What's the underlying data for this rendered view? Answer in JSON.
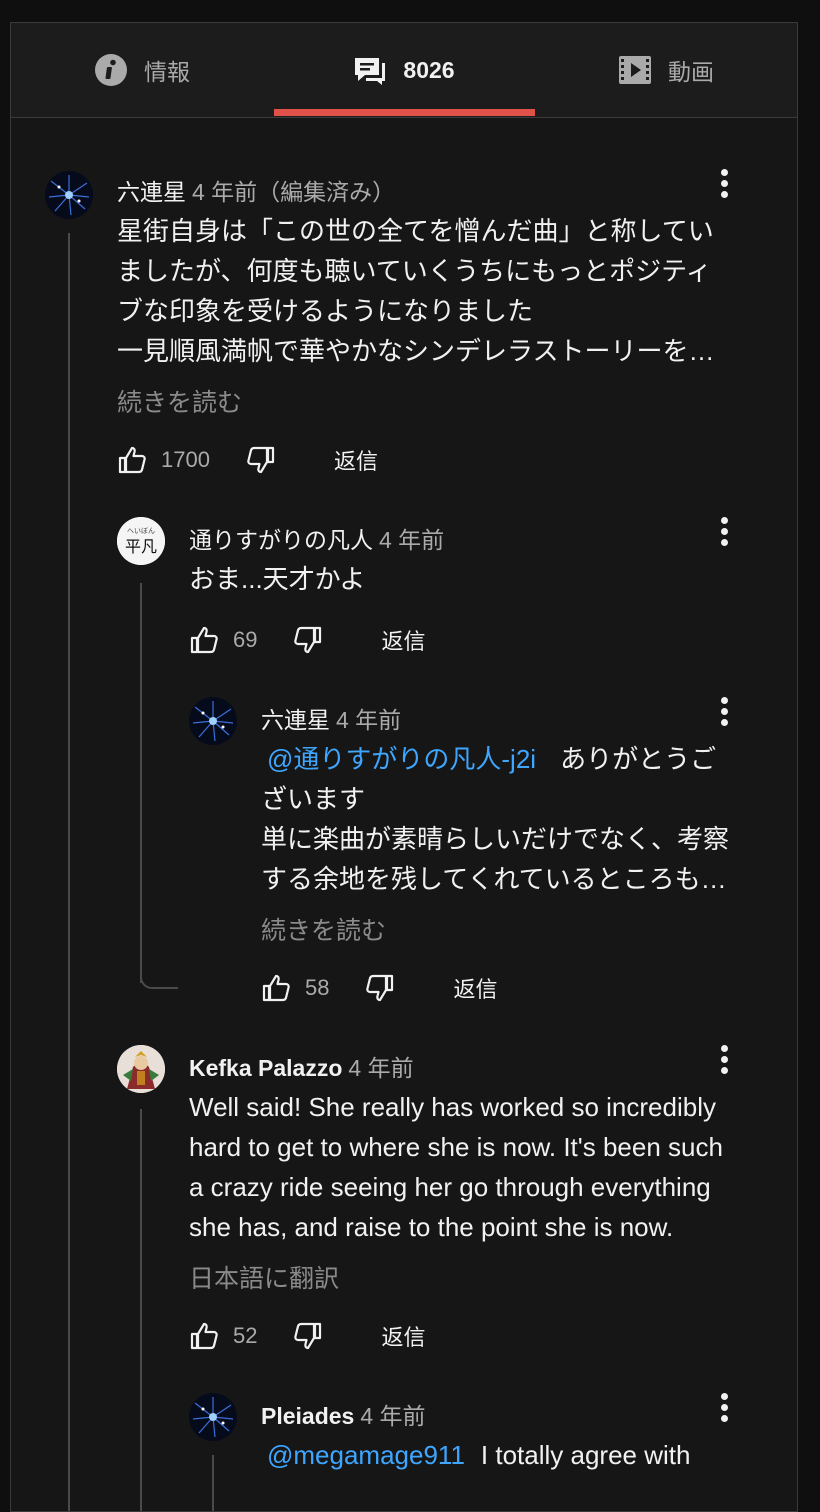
{
  "tabs": {
    "info_label": "情報",
    "comments_count": "8026",
    "video_label": "動画"
  },
  "comments": [
    {
      "author": "六連星",
      "time": "4 年前（編集済み）",
      "lines": [
        "星街自身は「この世の全てを憎んだ曲」と称してい",
        "ましたが、何度も聴いていくうちにもっとポジティ",
        "ブな印象を受けるようになりました",
        "一見順風満帆で華やかなシンデレラストーリーを…"
      ],
      "more": "続きを読む",
      "likes": "1700",
      "reply": "返信"
    },
    {
      "author": "通りすがりの凡人",
      "time": "4 年前",
      "avatar_text_small": "へいぼん",
      "avatar_text": "平凡",
      "lines": [
        "おま...天才かよ"
      ],
      "likes": "69",
      "reply": "返信"
    },
    {
      "author": "六連星",
      "time": "4 年前",
      "mention": "@通りすがりの凡人-j2i",
      "line1_rest": "ありがとうご",
      "lines": [
        "ざいます",
        "単に楽曲が素晴らしいだけでなく、考察",
        "する余地を残してくれているところも…"
      ],
      "more": "続きを読む",
      "likes": "58",
      "reply": "返信"
    },
    {
      "author": "Kefka Palazzo",
      "time": "4 年前",
      "lines": [
        "Well said! She really has worked so incredibly",
        "hard to get to where she is now. It's been such",
        "a crazy ride seeing her go through everything",
        "she has, and raise to the point she is now."
      ],
      "translate": "日本語に翻訳",
      "likes": "52",
      "reply": "返信"
    },
    {
      "author": "Pleiades",
      "time": "4 年前",
      "mention": "@megamage911",
      "line1_rest": "I totally agree with"
    }
  ]
}
